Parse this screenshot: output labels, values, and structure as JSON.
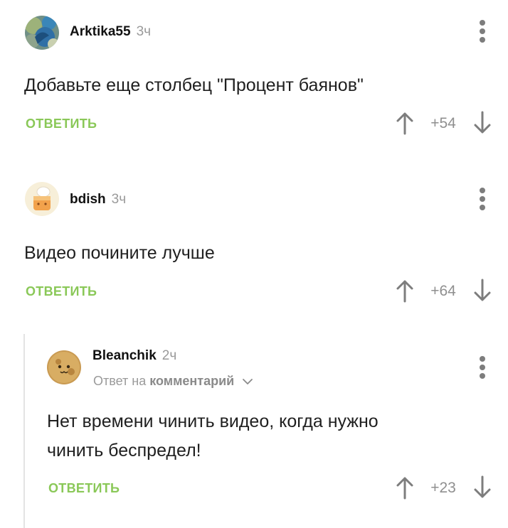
{
  "comments": [
    {
      "author": "Arktika55",
      "time": "3ч",
      "text": "Добавьте еще столбец \"Процент баянов\"",
      "reply_label": "ОТВЕТИТЬ",
      "rating": "+54"
    },
    {
      "author": "bdish",
      "time": "3ч",
      "text": "Видео почините лучше",
      "reply_label": "ОТВЕТИТЬ",
      "rating": "+64"
    },
    {
      "author": "Bleanchik",
      "time": "2ч",
      "reply_to_prefix": "Ответ на",
      "reply_to_link": "комментарий",
      "text_line1": "Нет времени чинить видео, когда нужно",
      "text_line2": "чинить беспредел!",
      "reply_label": "ОТВЕТИТЬ",
      "rating": "+23"
    }
  ],
  "colors": {
    "reply_green": "#8ac858",
    "muted_gray": "#9a9a9a",
    "icon_gray": "#7d7d7d"
  },
  "icons": [
    "more-vertical-icon",
    "arrow-up-icon",
    "arrow-down-icon",
    "chevron-down-icon"
  ]
}
